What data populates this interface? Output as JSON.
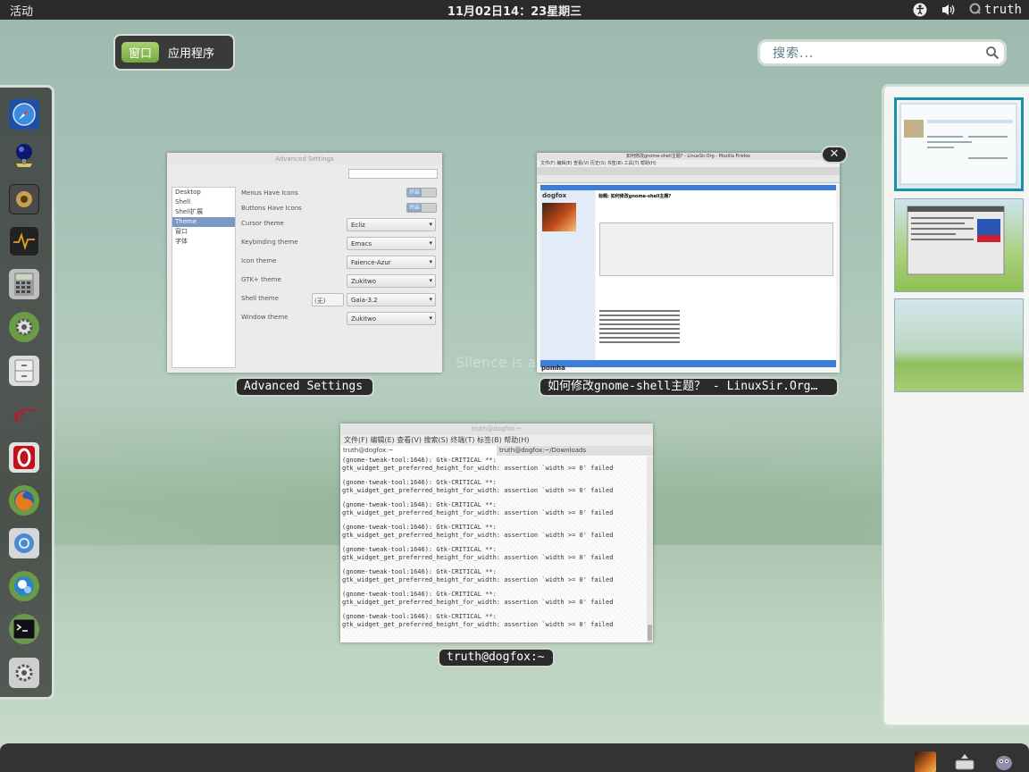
{
  "top_panel": {
    "activities": "活动",
    "clock": "11月02日14：23星期三",
    "user": "truth",
    "icons": [
      "accessibility-icon",
      "volume-icon",
      "user-status-icon"
    ]
  },
  "overview": {
    "view_selector": {
      "windows": "窗口",
      "applications": "应用程序",
      "active": "windows"
    },
    "search_placeholder": "搜索...",
    "background_text": "Silence is a cut"
  },
  "dash": {
    "items": [
      "safari-compass-icon",
      "sound-recorder-icon",
      "speaker-icon",
      "system-monitor-icon",
      "calculator-icon",
      "settings-gear-icon",
      "file-cabinet-icon",
      "epiphany-browser-icon",
      "opera-browser-icon",
      "firefox-browser-icon",
      "chromium-browser-icon",
      "messenger-icon",
      "terminal-icon",
      "tweak-tool-icon"
    ]
  },
  "windows": {
    "advanced_settings": {
      "caption": "Advanced Settings",
      "title": "Advanced Settings",
      "sidebar": [
        "Desktop",
        "Shell",
        "Shell扩展",
        "Theme",
        "窗口",
        "字体"
      ],
      "selected": "Theme",
      "rows": [
        {
          "label": "Menus Have Icons",
          "switch": "开启"
        },
        {
          "label": "Buttons Have Icons",
          "switch": "开启"
        },
        {
          "label": "Cursor theme",
          "value": "Ecliz"
        },
        {
          "label": "Keybinding theme",
          "value": "Emacs"
        },
        {
          "label": "Icon theme",
          "value": "Faience-Azur"
        },
        {
          "label": "GTK+ theme",
          "value": "Zukitwo"
        },
        {
          "label": "Shell theme",
          "value": "Gaia-3.2",
          "extra": "(无)"
        },
        {
          "label": "Window theme",
          "value": "Zukitwo"
        }
      ]
    },
    "firefox": {
      "caption": "如何修改gnome-shell主题？ - LinuxSir.Org…",
      "title": "如何修改gnome-shell主题? - LinuxSir.Org - Mozilla Firefox",
      "menu": "文件(F) 编辑(E) 查看(V) 历史(S) 书签(B) 工具(T) 帮助(H)",
      "site_name": "dogfox",
      "post_title": "标题: 如何修改gnome-shell主题?",
      "site_name_bottom": "pomha"
    },
    "terminal": {
      "caption": "truth@dogfox:~",
      "title": "truth@dogfox:~",
      "menu": "文件(F) 编辑(E) 查看(V) 搜索(S) 终端(T) 标签(B) 帮助(H)",
      "tabs": [
        "truth@dogfox:~",
        "truth@dogfox:~/Downloads"
      ],
      "lines": [
        "(gnome-tweak-tool:1646): Gtk-CRITICAL **: gtk_widget_get_preferred_height_for_width: assertion `width >= 0' failed",
        "(gnome-tweak-tool:1646): Gtk-CRITICAL **: gtk_widget_get_preferred_height_for_width: assertion `width >= 0' failed",
        "(gnome-tweak-tool:1646): Gtk-CRITICAL **: gtk_widget_get_preferred_height_for_width: assertion `width >= 0' failed",
        "(gnome-tweak-tool:1646): Gtk-CRITICAL **: gtk_widget_get_preferred_height_for_width: assertion `width >= 0' failed",
        "(gnome-tweak-tool:1646): Gtk-CRITICAL **: gtk_widget_get_preferred_height_for_width: assertion `width >= 0' failed",
        "(gnome-tweak-tool:1646): Gtk-CRITICAL **: gtk_widget_get_preferred_height_for_width: assertion `width >= 0' failed",
        "(gnome-tweak-tool:1646): Gtk-CRITICAL **: gtk_widget_get_preferred_height_for_width: assertion `width >= 0' failed",
        "(gnome-tweak-tool:1646): Gtk-CRITICAL **: gtk_widget_get_preferred_height_for_width: assertion `width >= 0' failed"
      ]
    }
  },
  "workspaces": {
    "count": 3,
    "active_index": 0
  },
  "bottom_tray": {
    "icons": [
      "rhythmbox-icon",
      "removable-drive-icon",
      "pidgin-icon"
    ]
  },
  "colors": {
    "accent": "#76a844",
    "panel": "#2b2b2b",
    "workspace_highlight": "#1a8fa8"
  }
}
